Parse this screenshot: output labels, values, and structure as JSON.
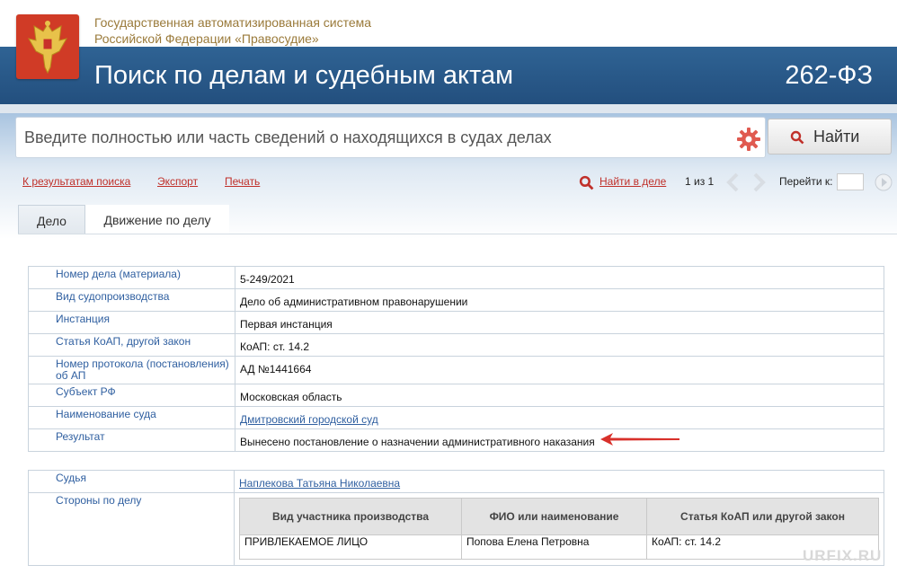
{
  "header": {
    "system_line1": "Государственная автоматизированная система",
    "system_line2": "Российской Федерации «Правосудие»",
    "title": "Поиск по делам и судебным актам",
    "law": "262-ФЗ"
  },
  "search": {
    "placeholder": "Введите полностью или часть сведений о находящихся в судах делах",
    "find_label": "Найти"
  },
  "toolbar": {
    "back_link": "К результатам поиска",
    "export_link": "Экспорт",
    "print_link": "Печать",
    "find_in_case": "Найти в деле",
    "pager": "1 из 1",
    "goto_label": "Перейти к:"
  },
  "tabs": [
    "Дело",
    "Движение по делу"
  ],
  "case_info": [
    {
      "label": "Номер дела (материала)",
      "value": "5-249/2021"
    },
    {
      "label": "Вид судопроизводства",
      "value": "Дело об административном правонарушении"
    },
    {
      "label": "Инстанция",
      "value": "Первая инстанция"
    },
    {
      "label": "Статья КоАП, другой закон",
      "value": "КоАП: ст. 14.2"
    },
    {
      "label": "Номер протокола (постановления) об АП",
      "value": "АД №1441664"
    },
    {
      "label": "Субъект РФ",
      "value": "Московская область"
    },
    {
      "label": "Наименование суда",
      "value": "Дмитровский городской суд"
    },
    {
      "label": "Результат",
      "value": "Вынесено постановление о назначении административного наказания"
    }
  ],
  "judge": {
    "label": "Судья",
    "value": "Наплекова Татьяна Николаевна"
  },
  "parties": {
    "label": "Стороны по делу",
    "headers": [
      "Вид участника производства",
      "ФИО или наименование",
      "Статья КоАП или другой закон"
    ],
    "rows": [
      [
        "ПРИВЛЕКАЕМОЕ ЛИЦО",
        "Попова Елена Петровна",
        "КоАП: ст. 14.2"
      ]
    ]
  },
  "watermark": "URFIX.RU",
  "colors": {
    "brand_blue": "#2a5a8c",
    "link_red": "#c0302a",
    "label_blue": "#2f5fa0",
    "arrow_red": "#d8302a"
  }
}
